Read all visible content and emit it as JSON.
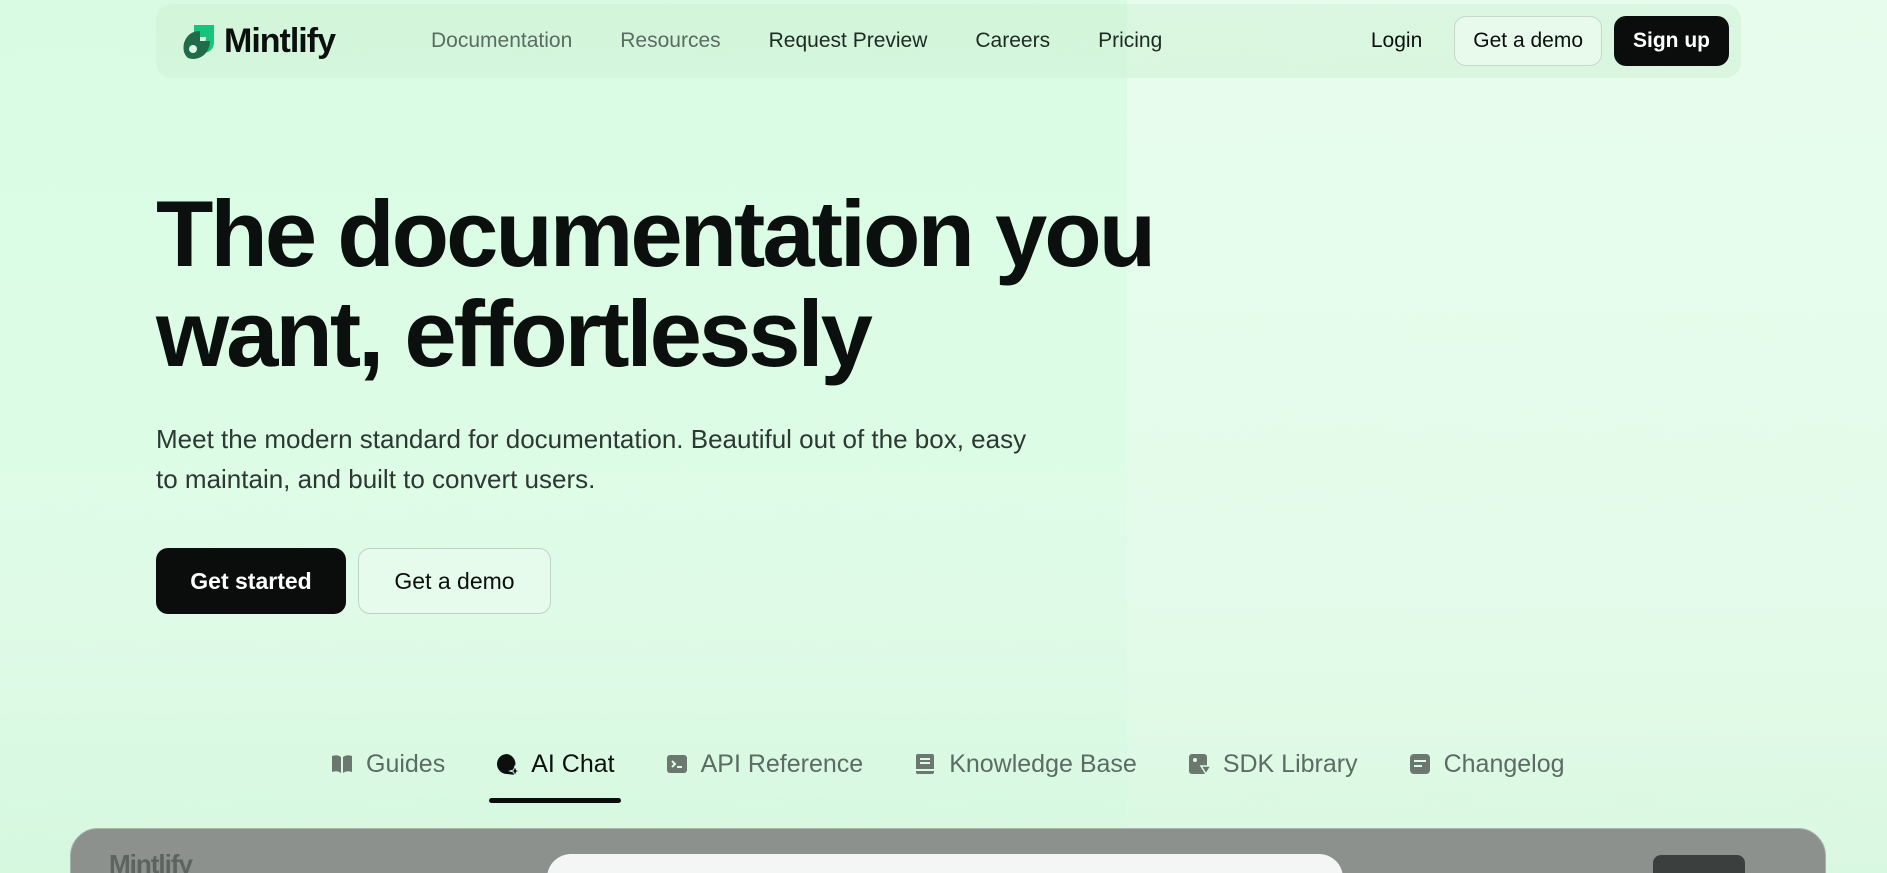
{
  "brand": {
    "name": "Mintlify",
    "accent": "#16a34a",
    "accent_light": "#4ade80"
  },
  "nav": {
    "links": [
      {
        "label": "Documentation",
        "muted": true
      },
      {
        "label": "Resources",
        "muted": true
      },
      {
        "label": "Request Preview",
        "muted": false
      },
      {
        "label": "Careers",
        "muted": false
      },
      {
        "label": "Pricing",
        "muted": false
      }
    ],
    "login": "Login",
    "demo": "Get a demo",
    "signup": "Sign up"
  },
  "hero": {
    "title_line1": "The documentation you",
    "title_line2": "want, effortlessly",
    "subtitle_line1": "Meet the modern standard for documentation. Beautiful out of the box, easy",
    "subtitle_line2": "to maintain, and built to convert users.",
    "cta_primary": "Get started",
    "cta_secondary": "Get a demo"
  },
  "tabs": [
    {
      "label": "Guides",
      "icon": "book-open-icon",
      "active": false
    },
    {
      "label": "AI Chat",
      "icon": "chat-sparkle-icon",
      "active": true
    },
    {
      "label": "API Reference",
      "icon": "terminal-icon",
      "active": false
    },
    {
      "label": "Knowledge Base",
      "icon": "book-icon",
      "active": false
    },
    {
      "label": "SDK Library",
      "icon": "sdk-icon",
      "active": false
    },
    {
      "label": "Changelog",
      "icon": "changelog-icon",
      "active": false
    }
  ],
  "preview": {
    "logo": "Mintlify"
  }
}
